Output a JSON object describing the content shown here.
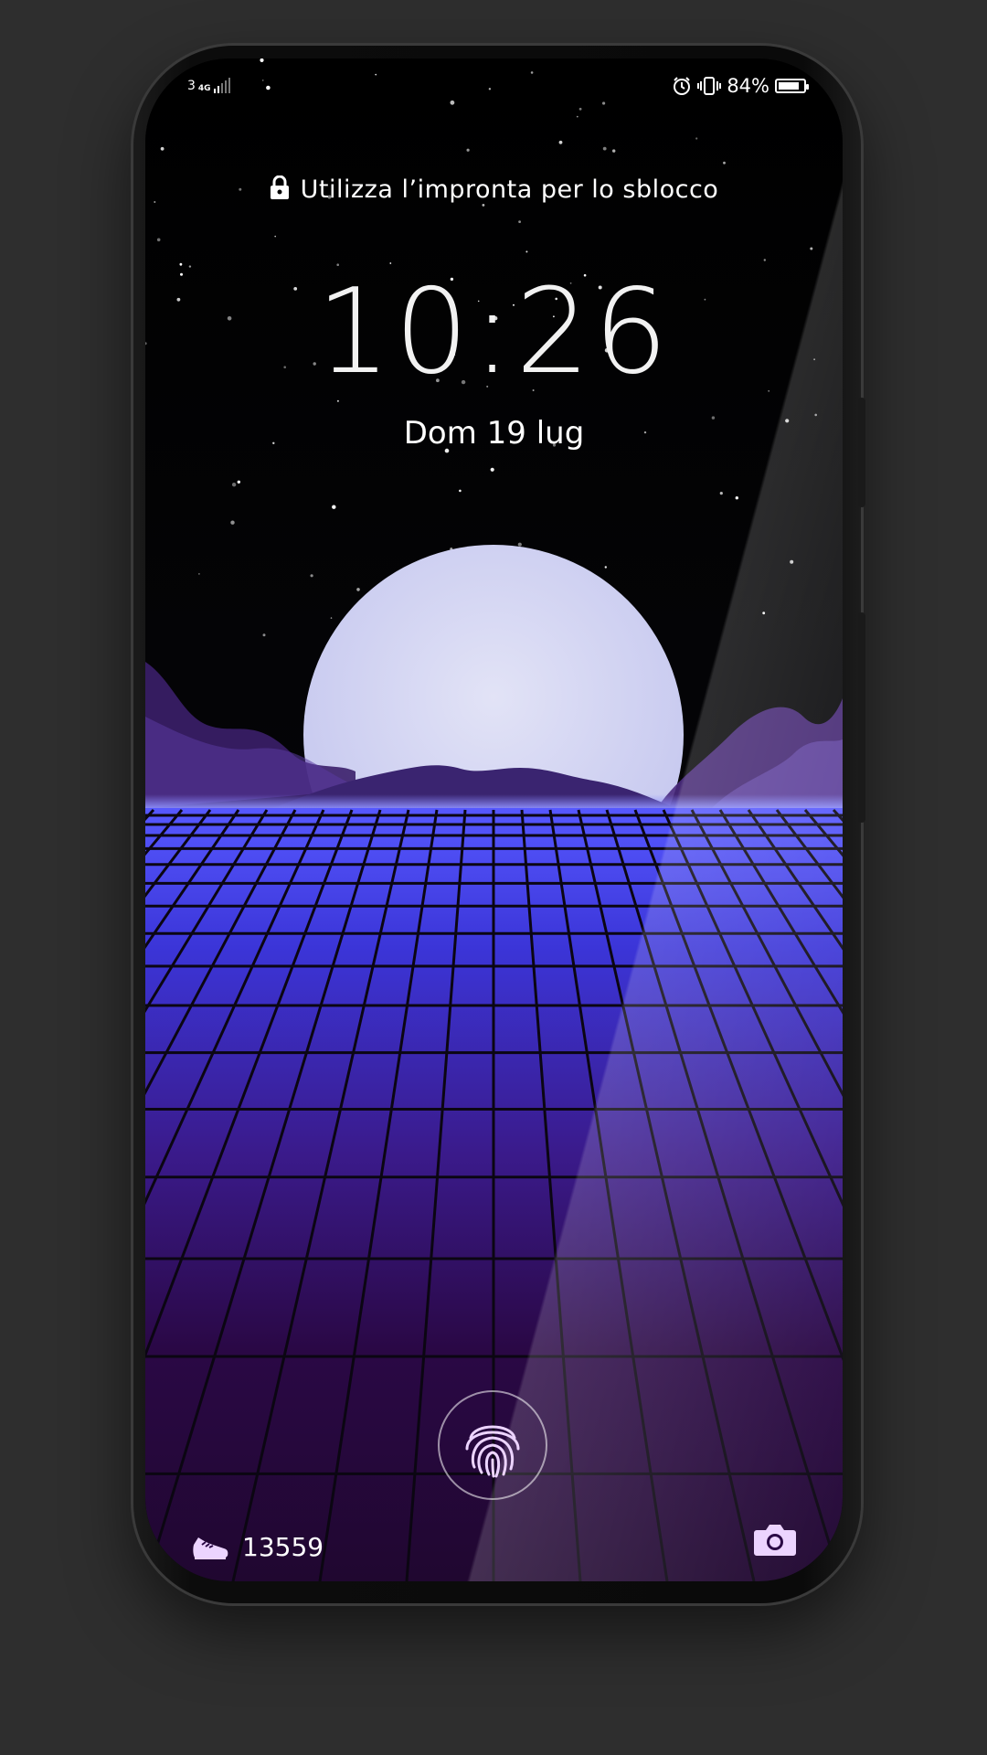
{
  "status_bar": {
    "sim_slot": "3",
    "network_type": "4G",
    "battery_percent": "84%",
    "battery_level": 0.84,
    "icons": [
      "signal-icon",
      "alarm-icon",
      "vibrate-icon",
      "battery-icon"
    ]
  },
  "lock_screen": {
    "hint": "Utilizza l’impronta per lo sblocco",
    "time": "10:26",
    "date": "Dom 19 lug"
  },
  "bottom_bar": {
    "steps": "13559",
    "icons": [
      "shoe-icon",
      "fingerprint-icon",
      "camera-icon"
    ]
  },
  "colors": {
    "background": "#2e2e2e",
    "moon": "#d4d6f2",
    "grid_top": "#4a4bf0",
    "grid_bottom": "#26062f",
    "accent": "#e6c6ff"
  }
}
